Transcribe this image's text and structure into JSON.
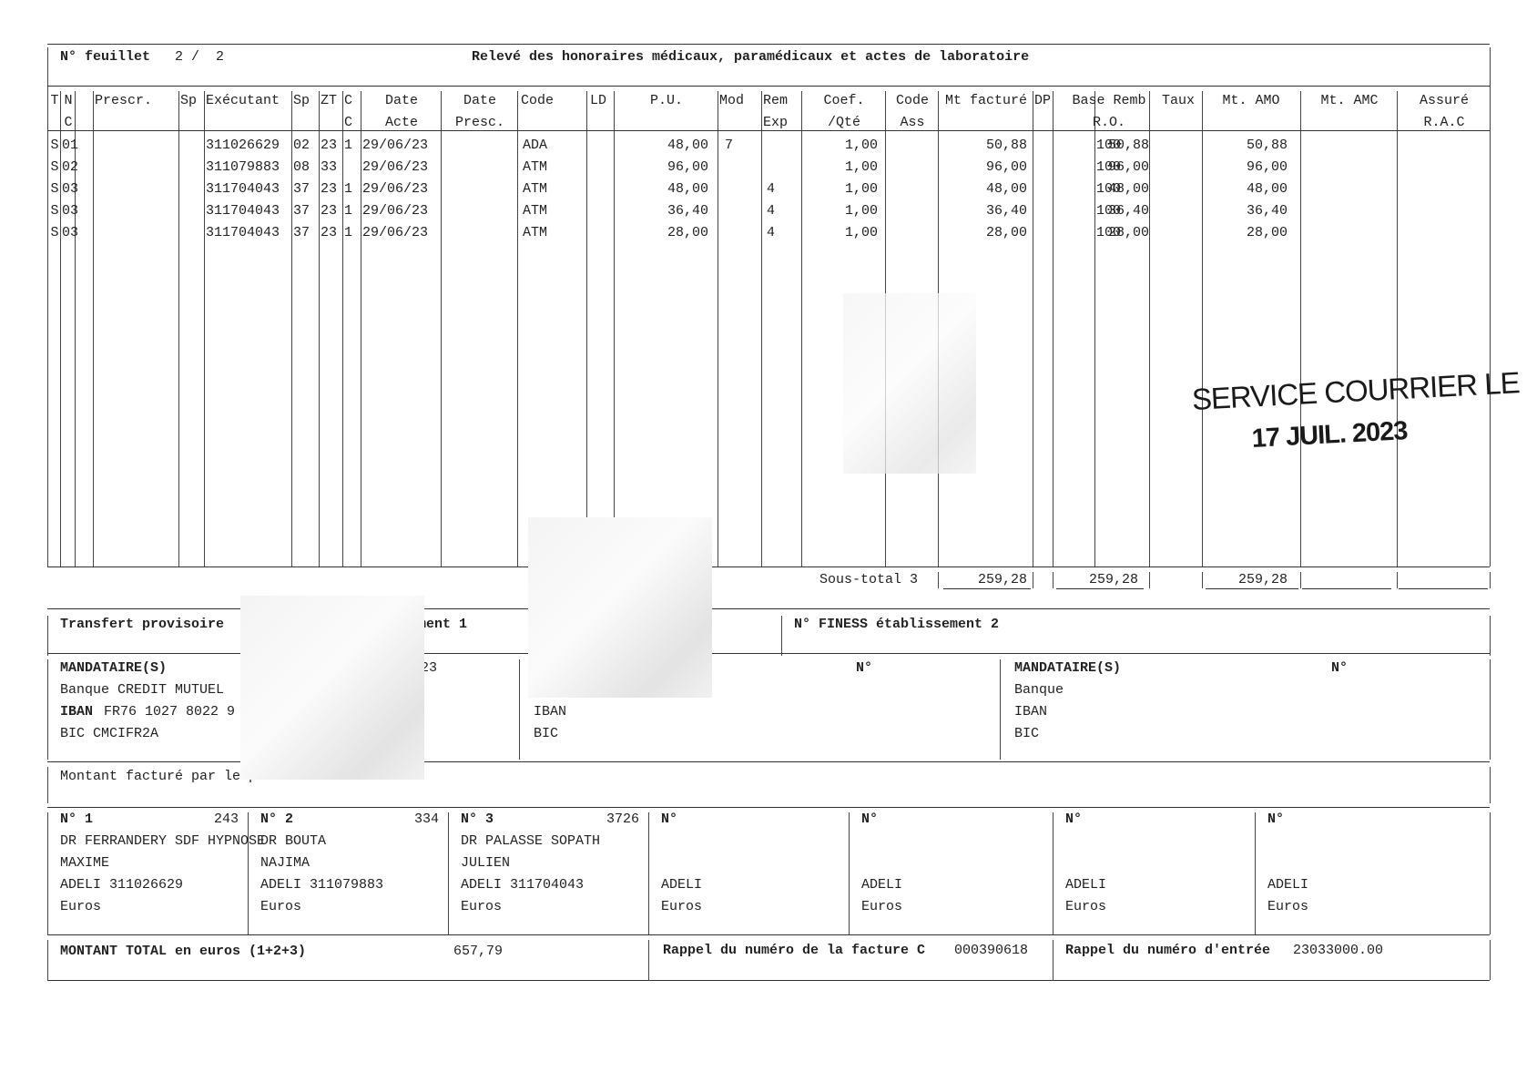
{
  "header": {
    "sheet_label": "N° feuillet",
    "sheet_value": "2 /  2",
    "title": "Relevé des honoraires médicaux, paramédicaux et actes de laboratoire"
  },
  "columns_row1": [
    "T",
    "N",
    "Prescr.",
    "Sp",
    "Exécutant",
    "Sp",
    "ZT",
    "C",
    "Date",
    "Date",
    "Code",
    "LD",
    "P.U.",
    "Mod",
    "Rem",
    "Coef.",
    "Code",
    "Mt facturé",
    "DP",
    "Base Remb",
    "Taux",
    "Mt. AMO",
    "Mt. AMC",
    "Assuré"
  ],
  "columns_row2": [
    "",
    "C",
    "",
    "",
    "",
    "",
    "",
    "C",
    "Acte",
    "Presc.",
    "",
    "",
    "",
    "",
    "Exp",
    "/Qté",
    "Ass",
    "",
    "",
    "R.O.",
    "",
    "",
    "",
    "R.A.C"
  ],
  "rows": [
    {
      "t": "S",
      "n": "01",
      "exec": "311026629",
      "sp": "02",
      "zt": "23",
      "c": "1",
      "date": "29/06/23",
      "code": "ADA",
      "pu": "48,00",
      "mod": "7",
      "rem": "",
      "coef": "1,00",
      "mt": "50,88",
      "base": "50,88",
      "taux": "100",
      "amo": "50,88"
    },
    {
      "t": "S",
      "n": "02",
      "exec": "311079883",
      "sp": "08",
      "zt": "33",
      "c": "",
      "date": "29/06/23",
      "code": "ATM",
      "pu": "96,00",
      "mod": "",
      "rem": "",
      "coef": "1,00",
      "mt": "96,00",
      "base": "96,00",
      "taux": "100",
      "amo": "96,00"
    },
    {
      "t": "S",
      "n": "03",
      "exec": "311704043",
      "sp": "37",
      "zt": "23",
      "c": "1",
      "date": "29/06/23",
      "code": "ATM",
      "pu": "48,00",
      "mod": "",
      "rem": "4",
      "coef": "1,00",
      "mt": "48,00",
      "base": "48,00",
      "taux": "100",
      "amo": "48,00"
    },
    {
      "t": "S",
      "n": "03",
      "exec": "311704043",
      "sp": "37",
      "zt": "23",
      "c": "1",
      "date": "29/06/23",
      "code": "ATM",
      "pu": "36,40",
      "mod": "",
      "rem": "4",
      "coef": "1,00",
      "mt": "36,40",
      "base": "36,40",
      "taux": "100",
      "amo": "36,40"
    },
    {
      "t": "S",
      "n": "03",
      "exec": "311704043",
      "sp": "37",
      "zt": "23",
      "c": "1",
      "date": "29/06/23",
      "code": "ATM",
      "pu": "28,00",
      "mod": "",
      "rem": "4",
      "coef": "1,00",
      "mt": "28,00",
      "base": "28,00",
      "taux": "100",
      "amo": "28,00"
    }
  ],
  "subtotal": {
    "label": "Sous-total 3",
    "mt": "259,28",
    "base": "259,28",
    "amo": "259,28"
  },
  "transfer": {
    "left": "Transfert provisoire",
    "left_partial": "ement 1",
    "right": "N° FINESS établissement 2"
  },
  "mandataires": {
    "col1": {
      "title": "MANDATAIRE(S)",
      "no_partial": "23",
      "bank": "Banque CREDIT MUTUEL",
      "iban_label": "IBAN",
      "iban_value": "FR76 1027 8022 9",
      "bic": "BIC CMCIFR2A"
    },
    "col2": {
      "no": "N°",
      "iban": "IBAN",
      "bic": "BIC"
    },
    "col3": {
      "title": "MANDATAIRE(S)",
      "no": "N°",
      "bank": "Banque",
      "iban": "IBAN",
      "bic": "BIC"
    }
  },
  "montant_praticien": "Montant facturé par le praticien",
  "practitioners": [
    {
      "no": "N° 1",
      "num": "243",
      "name1": "DR FERRANDERY SDF HYPNOSE",
      "name2": "MAXIME",
      "adeli": "ADELI 311026629",
      "euros": "Euros"
    },
    {
      "no": "N° 2",
      "num": "334",
      "name1": "DR BOUTA",
      "name2": "NAJIMA",
      "adeli": "ADELI 311079883",
      "euros": "Euros"
    },
    {
      "no": "N° 3",
      "num": "3726",
      "name1": "DR PALASSE SOPATH",
      "name2": "JULIEN",
      "adeli": "ADELI 311704043",
      "euros": "Euros"
    },
    {
      "no": "N°",
      "num": "",
      "name1": "",
      "name2": "",
      "adeli": "ADELI",
      "euros": "Euros"
    },
    {
      "no": "N°",
      "num": "",
      "name1": "",
      "name2": "",
      "adeli": "ADELI",
      "euros": "Euros"
    },
    {
      "no": "N°",
      "num": "",
      "name1": "",
      "name2": "",
      "adeli": "ADELI",
      "euros": "Euros"
    },
    {
      "no": "N°",
      "num": "",
      "name1": "",
      "name2": "",
      "adeli": "ADELI",
      "euros": "Euros"
    }
  ],
  "footer": {
    "total_label": "MONTANT TOTAL en euros (1+2+3)",
    "total_value": "657,79",
    "rappel_facture_label": "Rappel du numéro de la facture C",
    "rappel_facture_value": "000390618",
    "rappel_entree_label": "Rappel du numéro d'entrée",
    "rappel_entree_value": "23033000.00"
  },
  "stamp": {
    "line1": "SERVICE COURRIER LE",
    "line2": "17 JUIL. 2023"
  }
}
